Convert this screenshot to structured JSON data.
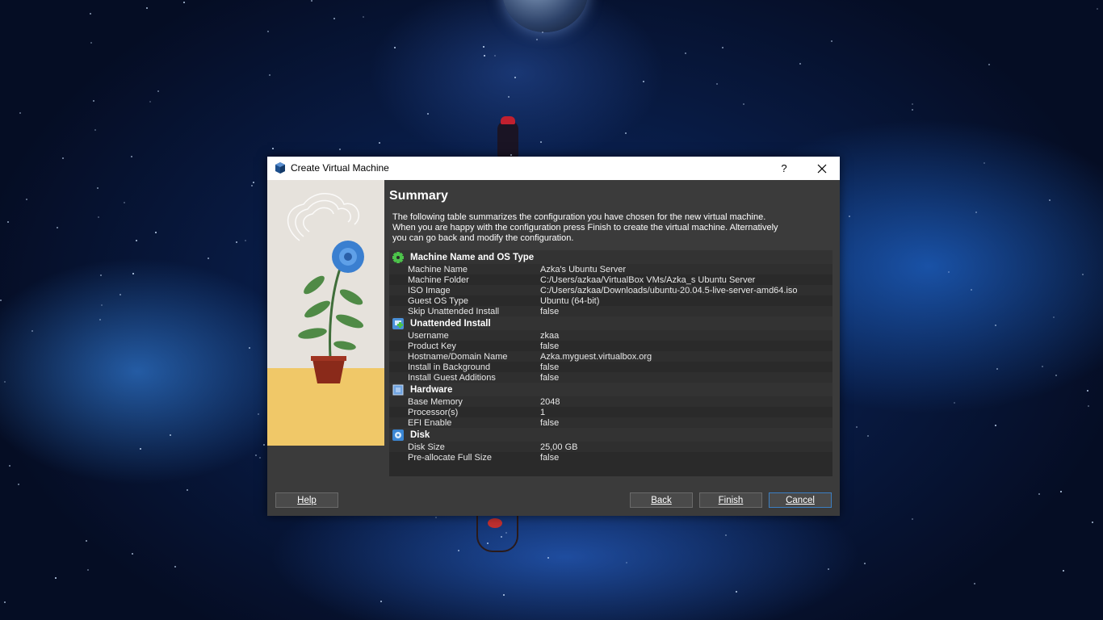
{
  "window": {
    "title": "Create Virtual Machine",
    "help_label": "?"
  },
  "page": {
    "heading": "Summary",
    "description_lines": [
      "The following table summarizes the configuration you have chosen for the new virtual machine.",
      "When you are happy with the configuration press Finish to create the virtual machine. Alternatively",
      "you can go back and modify the configuration."
    ]
  },
  "groups": [
    {
      "title": "Machine Name and OS Type",
      "icon": "gear-icon",
      "items": [
        {
          "key": "Machine Name",
          "value": "Azka's Ubuntu Server"
        },
        {
          "key": "Machine Folder",
          "value": "C:/Users/azkaa/VirtualBox VMs/Azka_s Ubuntu Server"
        },
        {
          "key": "ISO Image",
          "value": "C:/Users/azkaa/Downloads/ubuntu-20.04.5-live-server-amd64.iso"
        },
        {
          "key": "Guest OS Type",
          "value": "Ubuntu (64-bit)"
        },
        {
          "key": "Skip Unattended Install",
          "value": "false"
        }
      ]
    },
    {
      "title": "Unattended Install",
      "icon": "unattended-install-icon",
      "items": [
        {
          "key": "Username",
          "value": "zkaa"
        },
        {
          "key": "Product Key",
          "value": "false"
        },
        {
          "key": "Hostname/Domain Name",
          "value": "Azka.myguest.virtualbox.org"
        },
        {
          "key": "Install in Background",
          "value": "false"
        },
        {
          "key": "Install Guest Additions",
          "value": "false"
        }
      ]
    },
    {
      "title": "Hardware",
      "icon": "chip-icon",
      "items": [
        {
          "key": "Base Memory",
          "value": "2048"
        },
        {
          "key": "Processor(s)",
          "value": "1"
        },
        {
          "key": "EFI Enable",
          "value": "false"
        }
      ]
    },
    {
      "title": "Disk",
      "icon": "disk-icon",
      "items": [
        {
          "key": "Disk Size",
          "value": "25,00 GB"
        },
        {
          "key": "Pre-allocate Full Size",
          "value": "false"
        }
      ]
    }
  ],
  "buttons": {
    "help": "Help",
    "back": "Back",
    "finish": "Finish",
    "cancel": "Cancel"
  },
  "colors": {
    "dialog_bg": "#3b3b3b",
    "table_bg": "#2a2a2a",
    "focus_border": "#3c7fc2"
  }
}
